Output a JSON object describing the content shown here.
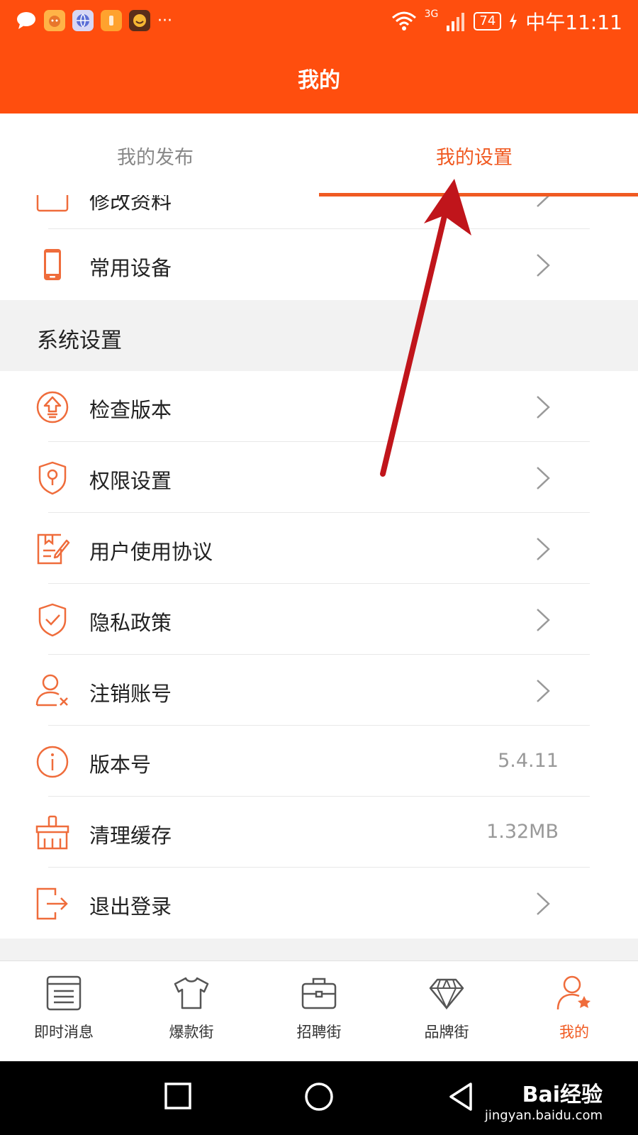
{
  "status_bar": {
    "network": "3G",
    "battery": "74",
    "time": "中午11:11",
    "more": "···"
  },
  "header": {
    "title": "我的"
  },
  "tabs": [
    {
      "label": "我的发布",
      "active": false
    },
    {
      "label": "我的设置",
      "active": true
    }
  ],
  "account_items": [
    {
      "label": "修改资料",
      "icon": "profile-card-icon"
    },
    {
      "label": "常用设备",
      "icon": "phone-icon"
    }
  ],
  "section_title": "系统设置",
  "settings_items": [
    {
      "label": "检查版本",
      "icon": "upgrade-icon",
      "value": ""
    },
    {
      "label": "权限设置",
      "icon": "shield-key-icon",
      "value": ""
    },
    {
      "label": "用户使用协议",
      "icon": "agreement-icon",
      "value": ""
    },
    {
      "label": "隐私政策",
      "icon": "shield-check-icon",
      "value": ""
    },
    {
      "label": "注销账号",
      "icon": "user-remove-icon",
      "value": ""
    },
    {
      "label": "版本号",
      "icon": "info-icon",
      "value": "5.4.11"
    },
    {
      "label": "清理缓存",
      "icon": "broom-icon",
      "value": "1.32MB"
    },
    {
      "label": "退出登录",
      "icon": "logout-icon",
      "value": ""
    }
  ],
  "bottom_nav": [
    {
      "label": "即时消息",
      "icon": "message-list-icon",
      "active": false
    },
    {
      "label": "爆款街",
      "icon": "tshirt-icon",
      "active": false
    },
    {
      "label": "招聘街",
      "icon": "briefcase-icon",
      "active": false
    },
    {
      "label": "品牌街",
      "icon": "diamond-icon",
      "active": false
    },
    {
      "label": "我的",
      "icon": "user-star-icon",
      "active": true
    }
  ],
  "watermark": {
    "brand": "Bai经验",
    "url": "jingyan.baidu.com"
  },
  "colors": {
    "header": "#ff4e0e",
    "accent": "#f05a22",
    "annotation_arrow": "#c0151b"
  }
}
